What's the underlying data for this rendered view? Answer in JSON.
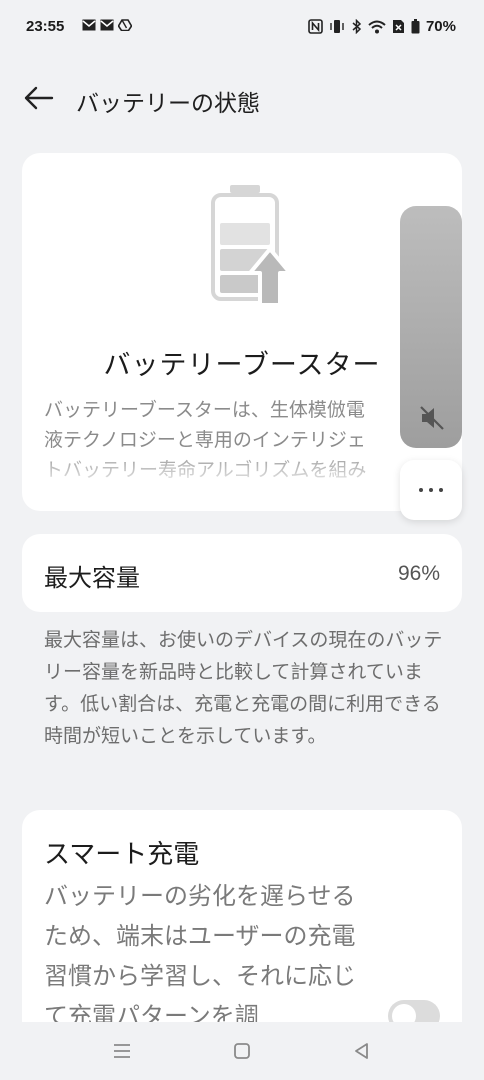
{
  "status_bar": {
    "time": "23:55",
    "left_icons": [
      "mail-icon",
      "mail-icon",
      "drive-icon"
    ],
    "right_icons": [
      "nfc-icon",
      "vibrate-icon",
      "bluetooth-icon",
      "wifi-icon",
      "no-sim-icon",
      "battery-icon"
    ],
    "battery_text": "70%"
  },
  "header": {
    "title": "バッテリーの状態"
  },
  "booster_card": {
    "title": "バッテリーブースター",
    "description_lines": [
      "バッテリーブースターは、生体模倣電",
      "液テクノロジーと専用のインテリジェ",
      "トバッテリー寿命アルゴリズムを組み"
    ]
  },
  "capacity_card": {
    "label": "最大容量",
    "value": "96%"
  },
  "capacity_description": "最大容量は、お使いのデバイスの現在のバッテリー容量を新品時と比較して計算されています。低い割合は、充電と充電の間に利用できる時間が短いことを示しています。",
  "smart_charging": {
    "title": "スマート充電",
    "description": "バッテリーの劣化を遅らせるため、端末はユーザーの充電習慣から学習し、それに応じて充電パターンを調",
    "enabled": false
  },
  "volume_overlay": {
    "icon": "mute-icon",
    "more_icon": "more-dots-icon"
  },
  "navigation": {
    "buttons": [
      "menu-icon",
      "home-icon",
      "back-icon"
    ]
  },
  "colors": {
    "background": "#f1f2f4",
    "card": "#ffffff",
    "volume_panel": "#a8a8a8"
  }
}
